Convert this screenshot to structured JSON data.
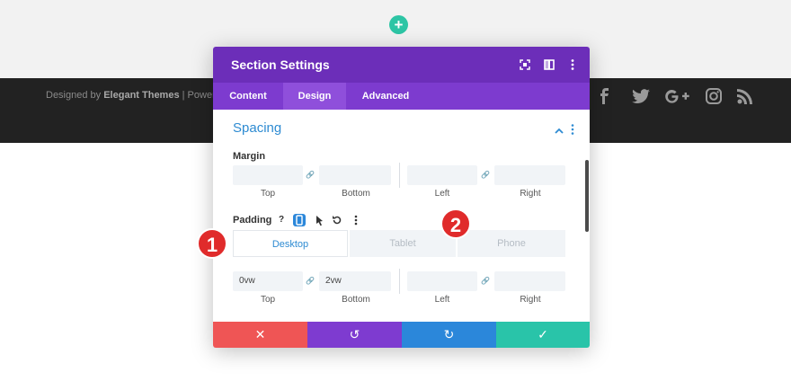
{
  "footer": {
    "prefix": "Designed by",
    "brand": "Elegant Themes",
    "suffix": "| Powere"
  },
  "add_button": "+",
  "modal": {
    "title": "Section Settings",
    "tabs": [
      "Content",
      "Design",
      "Advanced"
    ],
    "active_tab": "Design",
    "section_title": "Spacing",
    "margin": {
      "label": "Margin",
      "values": [
        "",
        "",
        "",
        ""
      ],
      "sublabels": [
        "Top",
        "Bottom",
        "Left",
        "Right"
      ]
    },
    "padding": {
      "label": "Padding",
      "device_tabs": [
        "Desktop",
        "Tablet",
        "Phone"
      ],
      "active_device": "Desktop",
      "values": [
        "0vw",
        "2vw",
        "",
        ""
      ],
      "sublabels": [
        "Top",
        "Bottom",
        "Left",
        "Right"
      ]
    },
    "buttons": {
      "cancel": "✕",
      "undo": "↺",
      "redo": "↻",
      "save": "✓"
    }
  },
  "callouts": [
    "1",
    "2"
  ],
  "colors": {
    "header": "#6c2eb9",
    "tabs": "#7d3bcf",
    "accent": "#2e8bd2",
    "cancel": "#ef5555",
    "undo": "#7e3bd0",
    "redo": "#2b87da",
    "save": "#29c4a9",
    "callout": "#e02b2b"
  },
  "icons": [
    "plus-icon",
    "facebook-icon",
    "twitter-icon",
    "google-plus-icon",
    "instagram-icon",
    "rss-icon",
    "fullscreen-icon",
    "split-view-icon",
    "more-vert-icon",
    "chevron-up-icon",
    "link-icon",
    "help-icon",
    "phone-device-icon",
    "pointer-icon",
    "reset-icon"
  ]
}
